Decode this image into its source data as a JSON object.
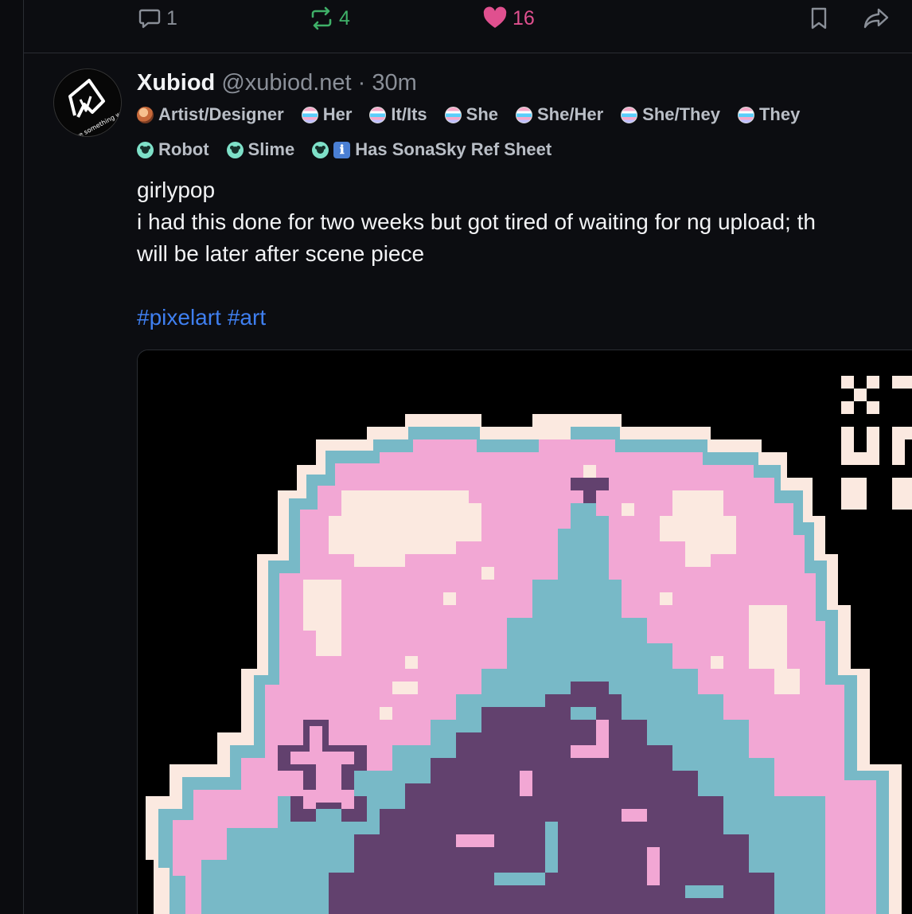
{
  "previous_post": {
    "reply_count": "1",
    "repost_count": "4",
    "like_count": "16"
  },
  "post": {
    "author": {
      "display_name": "Xubiod",
      "handle": "@xubiod.net",
      "separator": "·",
      "time": "30m",
      "avatar_text": "make something weird"
    },
    "labels_row1": [
      {
        "text": "Artist/Designer",
        "badge": "artist-badge"
      },
      {
        "text": "Her",
        "badge": "pride-badge"
      },
      {
        "text": "It/Its",
        "badge": "pride-badge"
      },
      {
        "text": "She",
        "badge": "pride-badge"
      },
      {
        "text": "She/Her",
        "badge": "pride-badge"
      },
      {
        "text": "She/They",
        "badge": "pride-badge"
      },
      {
        "text": "They",
        "badge": "pride-badge"
      }
    ],
    "labels_row2": [
      {
        "text": "Robot",
        "badge": "paw-badge"
      },
      {
        "text": "Slime",
        "badge": "paw-badge"
      },
      {
        "text": "Has SonaSky Ref Sheet",
        "badge": "paw-badge",
        "extra": "ℹ"
      }
    ],
    "text_lines": [
      "girlypop",
      "i had this done for two weeks but got tired of waiting for ng upload; th",
      "will be later after scene piece"
    ],
    "hashtags": [
      "#pixelart",
      "#art"
    ],
    "image": {
      "alt": "pixel art",
      "palette": {
        "background": "#000000",
        "pink": "#f2a7d4",
        "cream": "#fbe9e0",
        "teal": "#78b9c7",
        "purple": "#62416e"
      }
    }
  },
  "colors": {
    "like": "#e0508f",
    "repost": "#3fb068",
    "hashtag": "#3f7ff0",
    "muted": "#8a8f98"
  }
}
